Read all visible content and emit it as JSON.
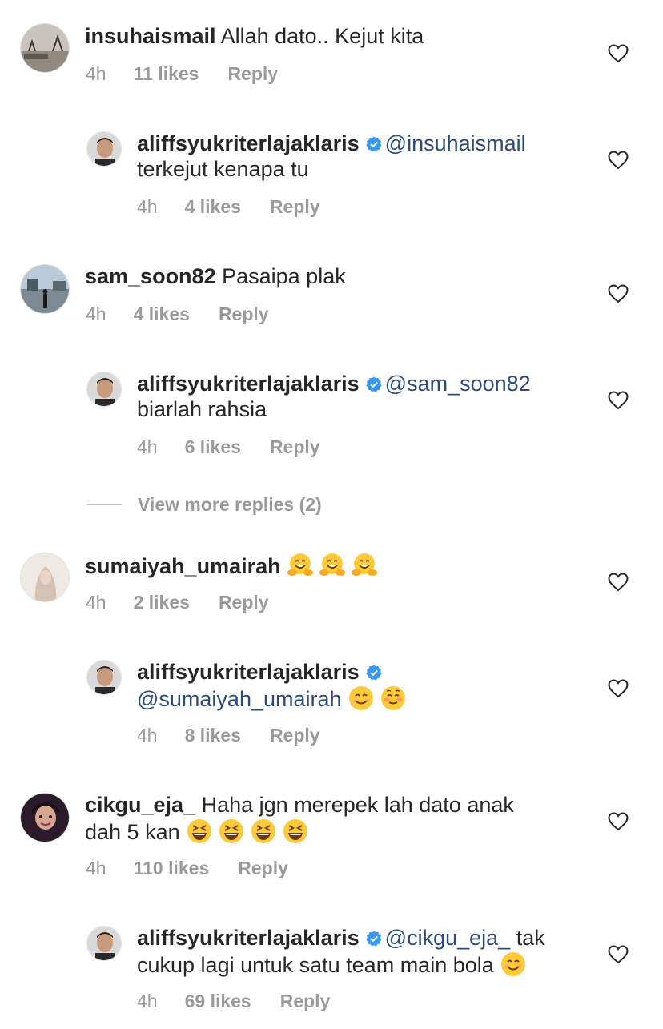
{
  "comments": [
    {
      "username": "insuhaismail",
      "text": "Allah dato.. Kejut kita",
      "time": "4h",
      "likes": "11 likes",
      "reply": "Reply",
      "avatar": "landscape-photo"
    },
    {
      "username": "aliffsyukriterlajaklaris",
      "mention": "@insuhaismail",
      "text": "terkejut kenapa tu",
      "time": "4h",
      "likes": "4 likes",
      "reply": "Reply",
      "avatar": "man-portrait"
    },
    {
      "username": "sam_soon82",
      "text": "Pasaipa plak",
      "time": "4h",
      "likes": "4 likes",
      "reply": "Reply",
      "avatar": "outdoor-photo"
    },
    {
      "username": "aliffsyukriterlajaklaris",
      "mention": "@sam_soon82",
      "text": "biarlah rahsia",
      "time": "4h",
      "likes": "6 likes",
      "reply": "Reply",
      "avatar": "man-portrait"
    },
    {
      "username": "sumaiyah_umairah",
      "text": "",
      "emojis": [
        "hugging-face-emoji",
        "hugging-face-emoji",
        "hugging-face-emoji"
      ],
      "time": "4h",
      "likes": "2 likes",
      "reply": "Reply",
      "avatar": "hijab-portrait"
    },
    {
      "username": "aliffsyukriterlajaklaris",
      "mention": "@sumaiyah_umairah",
      "text": "",
      "emojis": [
        "smiling-face-emoji",
        "blushing-face-emoji"
      ],
      "time": "4h",
      "likes": "8 likes",
      "reply": "Reply",
      "avatar": "man-portrait"
    },
    {
      "username": "cikgu_eja_",
      "text": "Haha jgn merepek lah dato anak",
      "text2": "dah 5 kan",
      "emojis": [
        "grinning-squint-emoji",
        "grinning-squint-emoji",
        "grinning-squint-emoji",
        "grinning-squint-emoji"
      ],
      "time": "4h",
      "likes": "110 likes",
      "reply": "Reply",
      "avatar": "woman-portrait"
    },
    {
      "username": "aliffsyukriterlajaklaris",
      "mention": "@cikgu_eja_",
      "text": "tak",
      "text2": "cukup lagi untuk satu team main bola",
      "emojis": [
        "smiling-face-emoji"
      ],
      "time": "4h",
      "likes": "69 likes",
      "reply": "Reply",
      "avatar": "man-portrait"
    }
  ],
  "view_more_replies": "View more replies (2)",
  "colors": {
    "mention": "#2c4a7a",
    "verified": "#3897f0",
    "meta": "#9a9a9a"
  }
}
